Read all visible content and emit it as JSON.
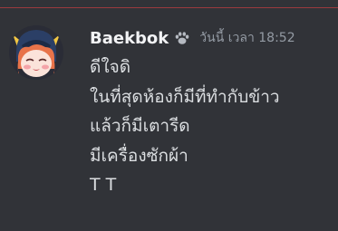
{
  "message": {
    "author": "Baekbok",
    "badge_icon": "paw-icon",
    "timestamp": "วันนี้ เวลา 18:52",
    "lines": [
      "ดีใจดิ",
      "ในที่สุดห้องก็มีที่ทำกับข้าว",
      "แล้วก็มีเตารีด",
      "มีเครื่องซักผ้า",
      "T T"
    ]
  },
  "colors": {
    "background": "#313338",
    "author": "#f2f3f5",
    "text": "#dbdee1",
    "timestamp": "#949ba4",
    "badge": "#b5bac1",
    "new_divider": "#f23f43"
  }
}
